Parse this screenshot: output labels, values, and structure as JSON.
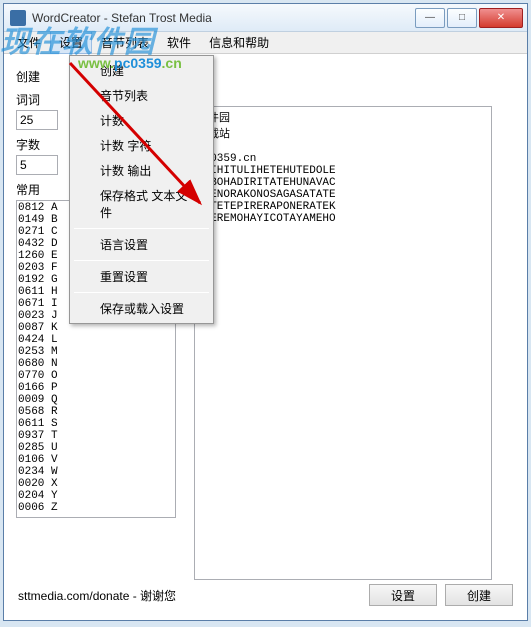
{
  "title": "WordCreator - Stefan Trost Media",
  "menubar": [
    "文件",
    "设置",
    "音节列表",
    "软件",
    "信息和帮助"
  ],
  "labels": {
    "create": "创建",
    "word_count": "词词",
    "word_count_val": "25",
    "char_count": "字数",
    "char_count_val": "5",
    "freq": "常用"
  },
  "dropdown": {
    "items": [
      "创建",
      "音节列表",
      "计数",
      "计数 字符",
      "计数 输出",
      "保存格式 文本文件",
      "-",
      "语言设置",
      "-",
      "重置设置",
      "-",
      "保存或载入设置"
    ]
  },
  "freq_list": "0812 A\n0149 B\n0271 C\n0432 D\n1260 E\n0203 F\n0192 G\n0611 H\n0671 I\n0023 J\n0087 K\n0424 L\n0253 M\n0680 N\n0770 O\n0166 P\n0009 Q\n0568 R\n0611 S\n0937 T\n0285 U\n0106 V\n0234 W\n0020 X\n0204 Y\n0006 Z",
  "output": "软件园\n下载站\n\npc0359.cn\nETIHITULIHETEHUTEDOLE\nCOBOHADIRITATEHUNAVAC\nEHENORAKONOSAGASATATE\nLETETEPIRERAPONERATEK\nAHEREMOHAYICOTAYAMEHO",
  "footer": {
    "text": "sttmedia.com/donate - 谢谢您",
    "btn_settings": "设置",
    "btn_create": "创建"
  },
  "watermark": {
    "brand_cn": "现在软件园",
    "url": "www.pc0359.cn"
  }
}
